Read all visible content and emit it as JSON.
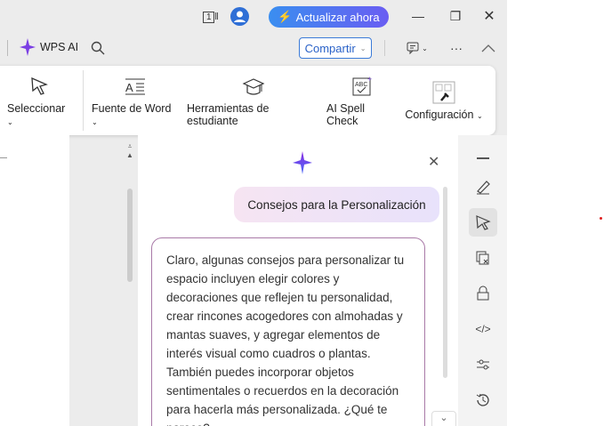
{
  "titlebar": {
    "page_badge": "1",
    "upgrade_label": "Actualizar ahora"
  },
  "toolbar": {
    "wps_ai_label": "WPS AI",
    "share_label": "Compartir"
  },
  "ribbon": {
    "items": [
      {
        "label": "Seleccionar",
        "icon": "cursor-icon"
      },
      {
        "label": "Fuente de Word",
        "icon": "font-icon"
      },
      {
        "label": "Herramientas de estudiante",
        "icon": "graduation-cap-icon"
      },
      {
        "label": "AI Spell Check",
        "icon": "spell-check-icon"
      },
      {
        "label": "Configuración",
        "icon": "settings-icon"
      }
    ]
  },
  "ai_panel": {
    "user_message": "Consejos para la Personalización",
    "response": "Claro, algunas consejos para personalizar tu espacio incluyen elegir colores y decoraciones que reflejen tu personalidad, crear rincones acogedores con almohadas y mantas suaves, y agregar elementos de interés visual como cuadros o plantas. También puedes incorporar objetos sentimentales o recuerdos en la decoración para hacerla más personalizada. ¿Qué te parece?"
  },
  "colors": {
    "accent": "#3b7bd8",
    "ai_purple": "#7b3fe4",
    "bubble": "#efe3f7",
    "border": "#a97aa8"
  }
}
